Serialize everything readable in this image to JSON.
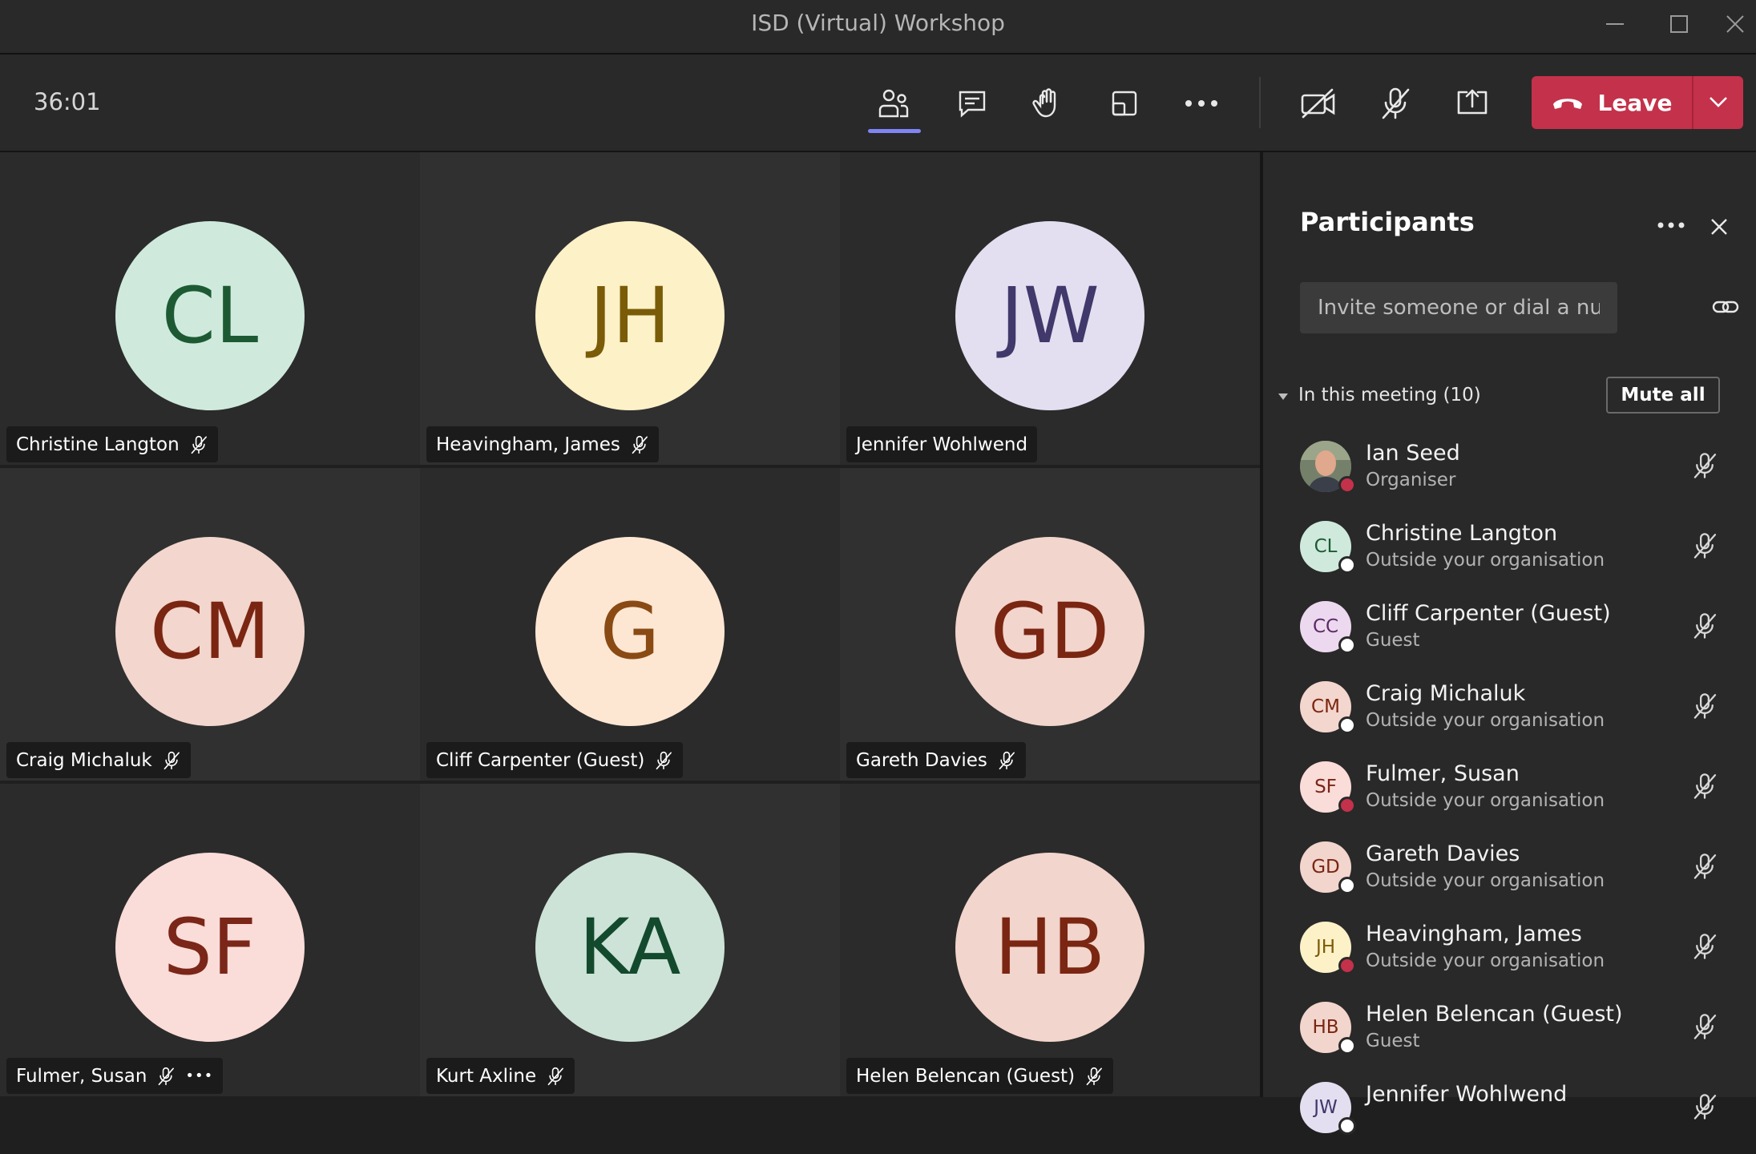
{
  "window": {
    "title": "ISD (Virtual) Workshop"
  },
  "toolbar": {
    "timer": "36:01",
    "leave_label": "Leave"
  },
  "tiles": [
    {
      "initials": "CL",
      "name": "Christine Langton",
      "bg": "#cfeadd",
      "fg": "#1d5a33",
      "muted": true
    },
    {
      "initials": "JH",
      "name": "Heavingham, James",
      "bg": "#fdf1c8",
      "fg": "#7a5b08",
      "muted": true
    },
    {
      "initials": "JW",
      "name": "Jennifer Wohlwend",
      "bg": "#e3dff0",
      "fg": "#41386b",
      "muted": false
    },
    {
      "initials": "CM",
      "name": "Craig Michaluk",
      "bg": "#f3d6cd",
      "fg": "#7a2612",
      "muted": true
    },
    {
      "initials": "G",
      "name": "Cliff Carpenter (Guest)",
      "bg": "#fde7d3",
      "fg": "#8a4a14",
      "muted": true
    },
    {
      "initials": "GD",
      "name": "Gareth Davies",
      "bg": "#f2d5cc",
      "fg": "#7a2612",
      "muted": true
    },
    {
      "initials": "SF",
      "name": "Fulmer, Susan",
      "bg": "#fadcd8",
      "fg": "#7a2618",
      "muted": true,
      "more": "•••"
    },
    {
      "initials": "KA",
      "name": "Kurt Axline",
      "bg": "#cde3d7",
      "fg": "#134a2d",
      "muted": true
    },
    {
      "initials": "HB",
      "name": "Helen Belencan (Guest)",
      "bg": "#f2d5cc",
      "fg": "#7a2612",
      "muted": true
    }
  ],
  "panel": {
    "title": "Participants",
    "invite_placeholder": "Invite someone or dial a number",
    "section_label": "In this meeting (10)",
    "mute_all_label": "Mute all",
    "participants": [
      {
        "initials": "",
        "name": "Ian Seed",
        "subtitle": "Organiser",
        "photo": true,
        "badge": "#c4314b"
      },
      {
        "initials": "CL",
        "name": "Christine Langton",
        "subtitle": "Outside your organisation",
        "bg": "#cfeadd",
        "fg": "#1d5a33",
        "badge": "#ffffff"
      },
      {
        "initials": "CC",
        "name": "Cliff Carpenter (Guest)",
        "subtitle": "Guest",
        "bg": "#ecd9ef",
        "fg": "#5c2a66",
        "badge": "#ffffff"
      },
      {
        "initials": "CM",
        "name": "Craig Michaluk",
        "subtitle": "Outside your organisation",
        "bg": "#f3d6cd",
        "fg": "#7a2612",
        "badge": "#ffffff"
      },
      {
        "initials": "SF",
        "name": "Fulmer, Susan",
        "subtitle": "Outside your organisation",
        "bg": "#fadcd8",
        "fg": "#7a2618",
        "badge": "#c4314b"
      },
      {
        "initials": "GD",
        "name": "Gareth Davies",
        "subtitle": "Outside your organisation",
        "bg": "#f2d5cc",
        "fg": "#7a2612",
        "badge": "#ffffff"
      },
      {
        "initials": "JH",
        "name": "Heavingham, James",
        "subtitle": "Outside your organisation",
        "bg": "#fdf1c8",
        "fg": "#7a5b08",
        "badge": "#c4314b"
      },
      {
        "initials": "HB",
        "name": "Helen Belencan (Guest)",
        "subtitle": "Guest",
        "bg": "#f2d5cc",
        "fg": "#7a2612",
        "badge": "#ffffff"
      },
      {
        "initials": "JW",
        "name": "Jennifer Wohlwend",
        "subtitle": "",
        "bg": "#e3dff0",
        "fg": "#41386b",
        "badge": "#ffffff"
      }
    ]
  },
  "icons": {
    "toolbar": [
      "people-icon",
      "chat-icon",
      "raise-hand-icon",
      "view-icon",
      "more-icon",
      "camera-off-icon",
      "mic-off-icon",
      "share-screen-icon"
    ],
    "leave": "phone-hangup-icon",
    "window_controls": [
      "minimize-icon",
      "maximize-icon",
      "close-icon"
    ]
  },
  "colors": {
    "accent": "#7f85f5",
    "leave": "#c4314b",
    "muted_badge": "#c4314b"
  }
}
